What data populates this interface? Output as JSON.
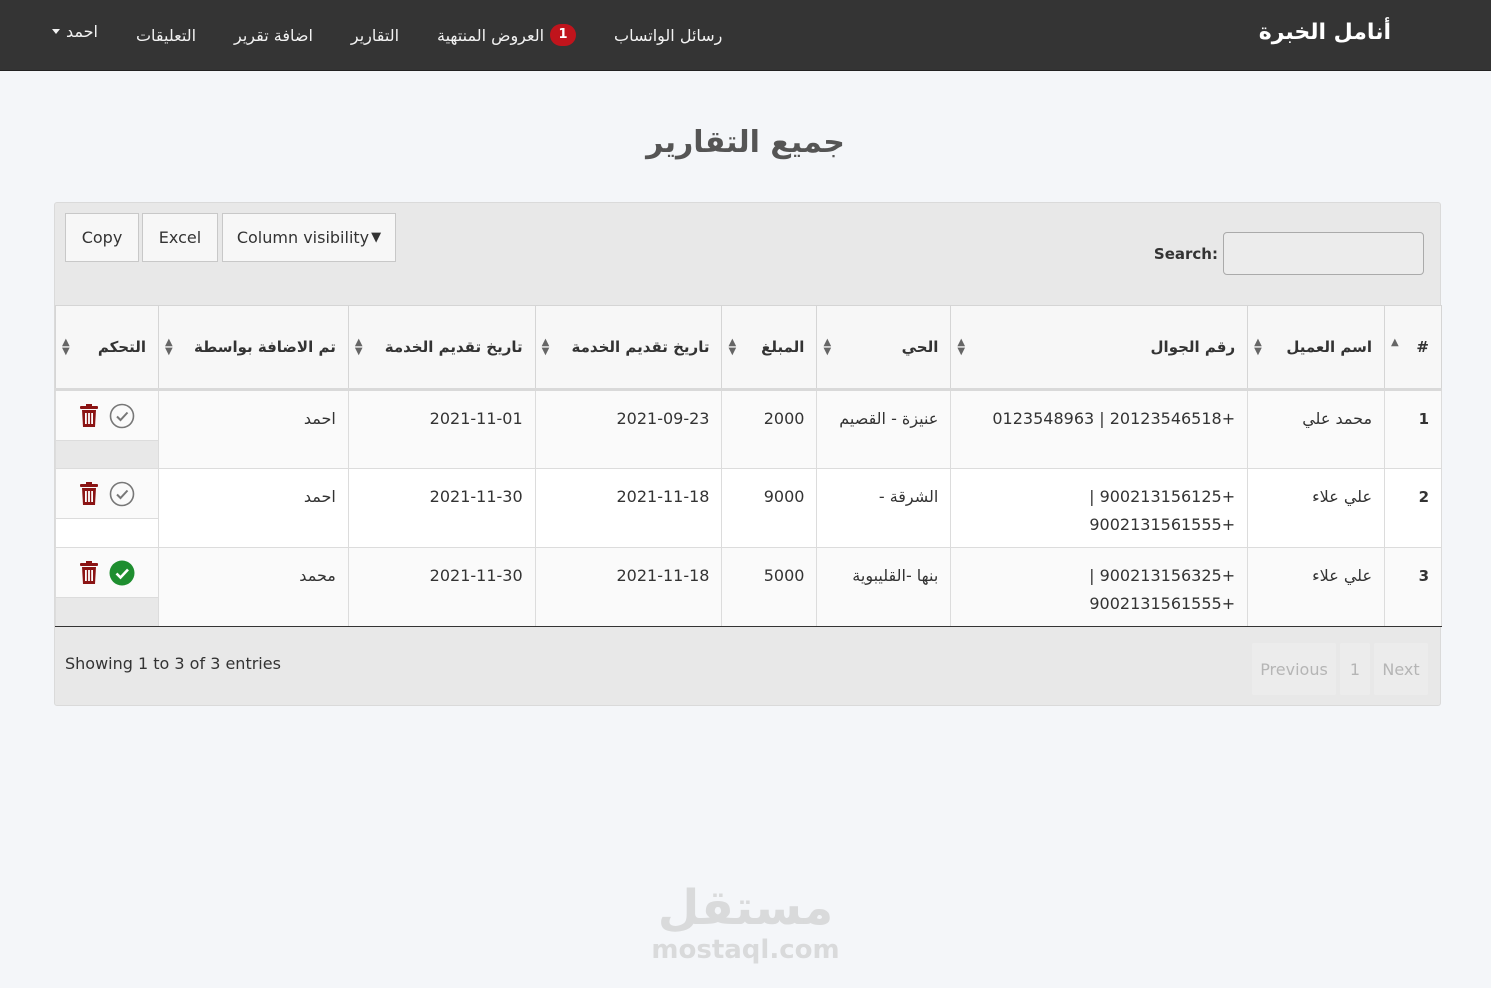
{
  "navbar": {
    "brand": "أنامل الخبرة",
    "links": [
      {
        "label": "رسائل الواتساب"
      },
      {
        "label": "العروض المنتهية",
        "badge": "1"
      },
      {
        "label": "التقارير"
      },
      {
        "label": "اضافة تقرير"
      },
      {
        "label": "التعليقات"
      }
    ],
    "user": "احمد"
  },
  "page_title": "جميع التقارير",
  "toolbar": {
    "copy_label": "Copy",
    "excel_label": "Excel",
    "column_visibility_label": "Column visibility",
    "search_label": "Search:",
    "search_value": ""
  },
  "table": {
    "headers": {
      "num": "#",
      "client_name": "اسم العميل",
      "phone": "رقم الجوال",
      "district": "الحي",
      "amount": "المبلغ",
      "service_date_1": "تاريخ تقديم الخدمة",
      "service_date_2": "تاريخ تقديم الخدمة",
      "added_by": "تم الاضافة بواسطة",
      "control": "التحكم"
    },
    "rows": [
      {
        "num": "1",
        "client_name": "محمد علي",
        "phone": "+20123546518 | 0123548963",
        "district": "عنيزة - القصيم",
        "amount": "2000",
        "service_date_1": "2021-09-23",
        "service_date_2": "2021-11-01",
        "added_by": "احمد",
        "done": false
      },
      {
        "num": "2",
        "client_name": "علي علاء",
        "phone": "+900213156125 | +9002131561555",
        "district": "الشرقة -",
        "amount": "9000",
        "service_date_1": "2021-11-18",
        "service_date_2": "2021-11-30",
        "added_by": "احمد",
        "done": false
      },
      {
        "num": "3",
        "client_name": "علي علاء",
        "phone": "+900213156325 | +9002131561555",
        "district": "بنها -القليبوية",
        "amount": "5000",
        "service_date_1": "2021-11-18",
        "service_date_2": "2021-11-30",
        "added_by": "محمد",
        "done": true
      }
    ]
  },
  "footer": {
    "info": "Showing 1 to 3 of 3 entries",
    "previous_label": "Previous",
    "page": "1",
    "next_label": "Next"
  },
  "watermark": {
    "arabic": "مستقل",
    "latin": "mostaql.com"
  },
  "colors": {
    "navbar_bg": "#343434",
    "badge": "#c0141c",
    "trash": "#8b1414",
    "check_done": "#1e8e2f"
  }
}
